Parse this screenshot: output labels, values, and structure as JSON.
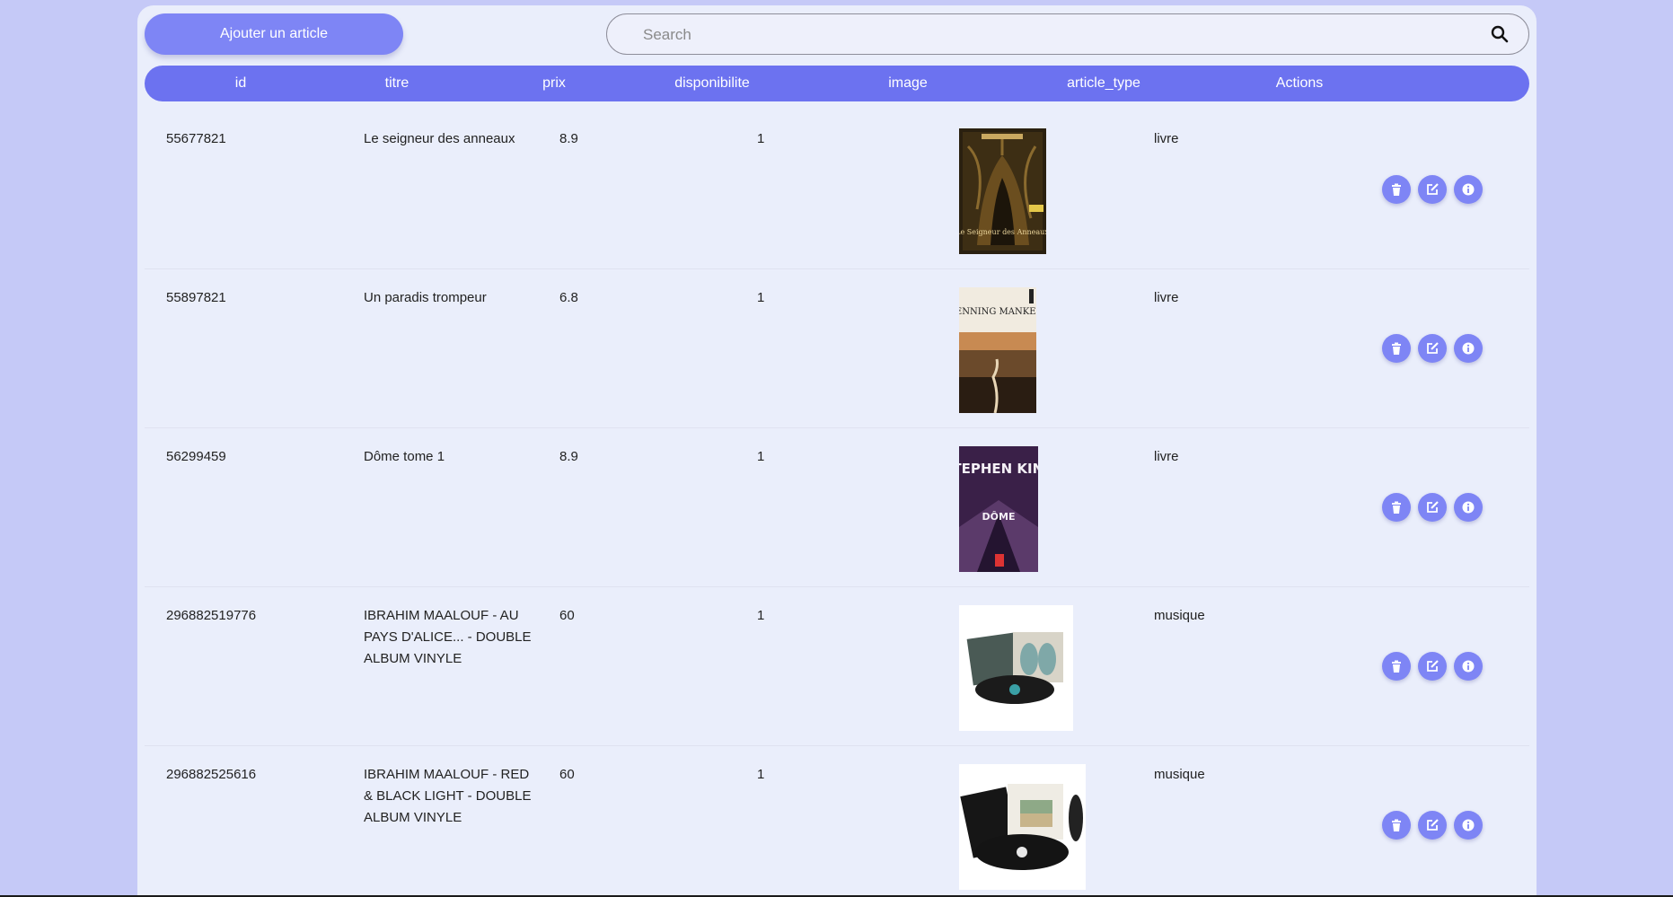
{
  "toolbar": {
    "add_label": "Ajouter un article",
    "search_placeholder": "Search"
  },
  "table": {
    "columns": [
      "id",
      "titre",
      "prix",
      "disponibilite",
      "image",
      "article_type",
      "Actions"
    ],
    "rows": [
      {
        "id": "55677821",
        "titre": "Le seigneur des anneaux",
        "prix": "8.9",
        "disponibilite": "1",
        "image_alt": "Le Seigneur des Anneaux cover",
        "cover_text": "Le Seigneur des Anneaux",
        "article_type": "livre"
      },
      {
        "id": "55897821",
        "titre": "Un paradis trompeur",
        "prix": "6.8",
        "disponibilite": "1",
        "image_alt": "Un paradis trompeur cover",
        "cover_text": "HENNING MANKELL",
        "article_type": "livre"
      },
      {
        "id": "56299459",
        "titre": "Dôme tome 1",
        "prix": "8.9",
        "disponibilite": "1",
        "image_alt": "Dôme cover",
        "cover_text": "STEPHEN KING",
        "cover_text2": "DÔME",
        "article_type": "livre"
      },
      {
        "id": "296882519776",
        "titre": "IBRAHIM MAALOUF - AU PAYS D'ALICE... - DOUBLE ALBUM VINYLE",
        "prix": "60",
        "disponibilite": "1",
        "image_alt": "Au pays d'Alice vinyl",
        "article_type": "musique"
      },
      {
        "id": "296882525616",
        "titre": "IBRAHIM MAALOUF - RED & BLACK LIGHT - DOUBLE ALBUM VINYLE",
        "prix": "60",
        "disponibilite": "1",
        "image_alt": "Red & Black Light vinyl",
        "article_type": "musique"
      }
    ]
  },
  "icons": {
    "delete": "trash-icon",
    "edit": "edit-icon",
    "info": "info-icon",
    "search": "search-icon"
  },
  "colors": {
    "accent": "#6c72f0",
    "button": "#7e85f5",
    "background": "#c5c9f7",
    "panel": "#eaeefb"
  }
}
